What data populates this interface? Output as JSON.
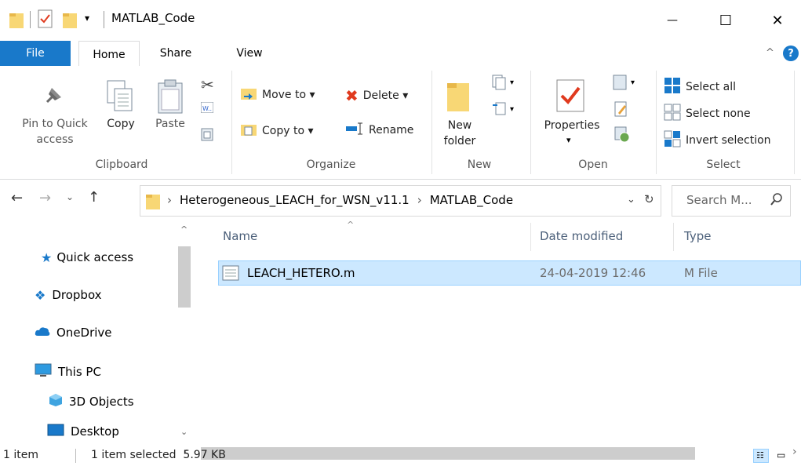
{
  "window": {
    "title": "MATLAB_Code",
    "minimize_label": "—",
    "maximize_label": "☐",
    "close_label": "✕"
  },
  "ribbon_tabs": {
    "file": "File",
    "home": "Home",
    "share": "Share",
    "view": "View"
  },
  "clipboard": {
    "pin_line1": "Pin to Quick",
    "pin_line2": "access",
    "copy": "Copy",
    "paste": "Paste",
    "group": "Clipboard"
  },
  "organize": {
    "move_to": "Move to ▾",
    "copy_to": "Copy to ▾",
    "delete": "Delete ▾",
    "rename": "Rename",
    "group": "Organize"
  },
  "new_group": {
    "new_folder_line1": "New",
    "new_folder_line2": "folder",
    "group": "New"
  },
  "open_group": {
    "properties": "Properties",
    "group": "Open"
  },
  "select_group": {
    "select_all": "Select all",
    "select_none": "Select none",
    "invert_selection": "Invert selection",
    "group": "Select"
  },
  "address": {
    "crumb1": "Heterogeneous_LEACH_for_WSN_v11.1",
    "crumb2": "MATLAB_Code",
    "separator": "›"
  },
  "search": {
    "placeholder": "Search M..."
  },
  "navigation": {
    "quick_access": "Quick access",
    "dropbox": "Dropbox",
    "onedrive": "OneDrive",
    "this_pc": "This PC",
    "objects3d": "3D Objects",
    "desktop": "Desktop"
  },
  "columns": {
    "name": "Name",
    "date_modified": "Date modified",
    "type": "Type"
  },
  "files": [
    {
      "name": "LEACH_HETERO.m",
      "date": "24-04-2019 12:46",
      "type": "M File"
    }
  ],
  "status": {
    "count": "1 item",
    "selected": "1 item selected  5.97 KB"
  },
  "colors": {
    "file_tab": "#1979ca",
    "selection": "#cce8ff",
    "selection_border": "#99d1ff",
    "folder": "#f8d775",
    "accent_blue": "#0078d7"
  }
}
